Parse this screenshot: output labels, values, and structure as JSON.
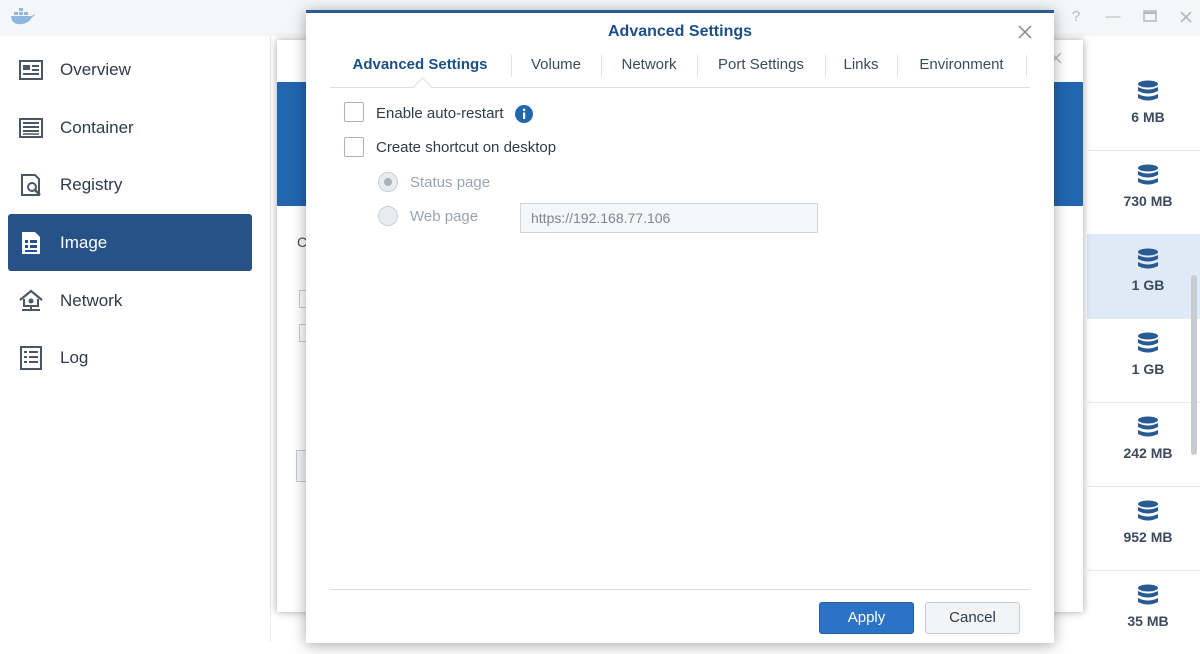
{
  "window": {
    "help_glyph": "?",
    "minimize_glyph": "—"
  },
  "sidebar": {
    "items": [
      {
        "label": "Overview",
        "icon": "overview-icon"
      },
      {
        "label": "Container",
        "icon": "container-icon"
      },
      {
        "label": "Registry",
        "icon": "registry-icon"
      },
      {
        "label": "Image",
        "icon": "image-icon",
        "active": true
      },
      {
        "label": "Network",
        "icon": "network-icon"
      },
      {
        "label": "Log",
        "icon": "log-icon"
      }
    ]
  },
  "image_list": {
    "sizes": [
      "6 MB",
      "730 MB",
      "1 GB",
      "1 GB",
      "242 MB",
      "952 MB",
      "35 MB"
    ],
    "selected_index": 2
  },
  "background_dialog": {
    "fragment": "C"
  },
  "modal": {
    "title": "Advanced Settings",
    "tabs": [
      "Advanced Settings",
      "Volume",
      "Network",
      "Port Settings",
      "Links",
      "Environment"
    ],
    "active_tab": 0,
    "enable_auto_restart": {
      "label": "Enable auto-restart",
      "checked": false
    },
    "create_shortcut": {
      "label": "Create shortcut on desktop",
      "checked": false
    },
    "status_page": {
      "label": "Status page",
      "checked": true,
      "disabled": true
    },
    "web_page": {
      "label": "Web page",
      "checked": false,
      "disabled": true
    },
    "web_page_url": "https://192.168.77.106",
    "apply_label": "Apply",
    "cancel_label": "Cancel"
  },
  "colors": {
    "accent": "#2266b0",
    "sidebar_active": "#275288",
    "apply_button": "#2b73c4",
    "selected_row": "#deebf7"
  }
}
